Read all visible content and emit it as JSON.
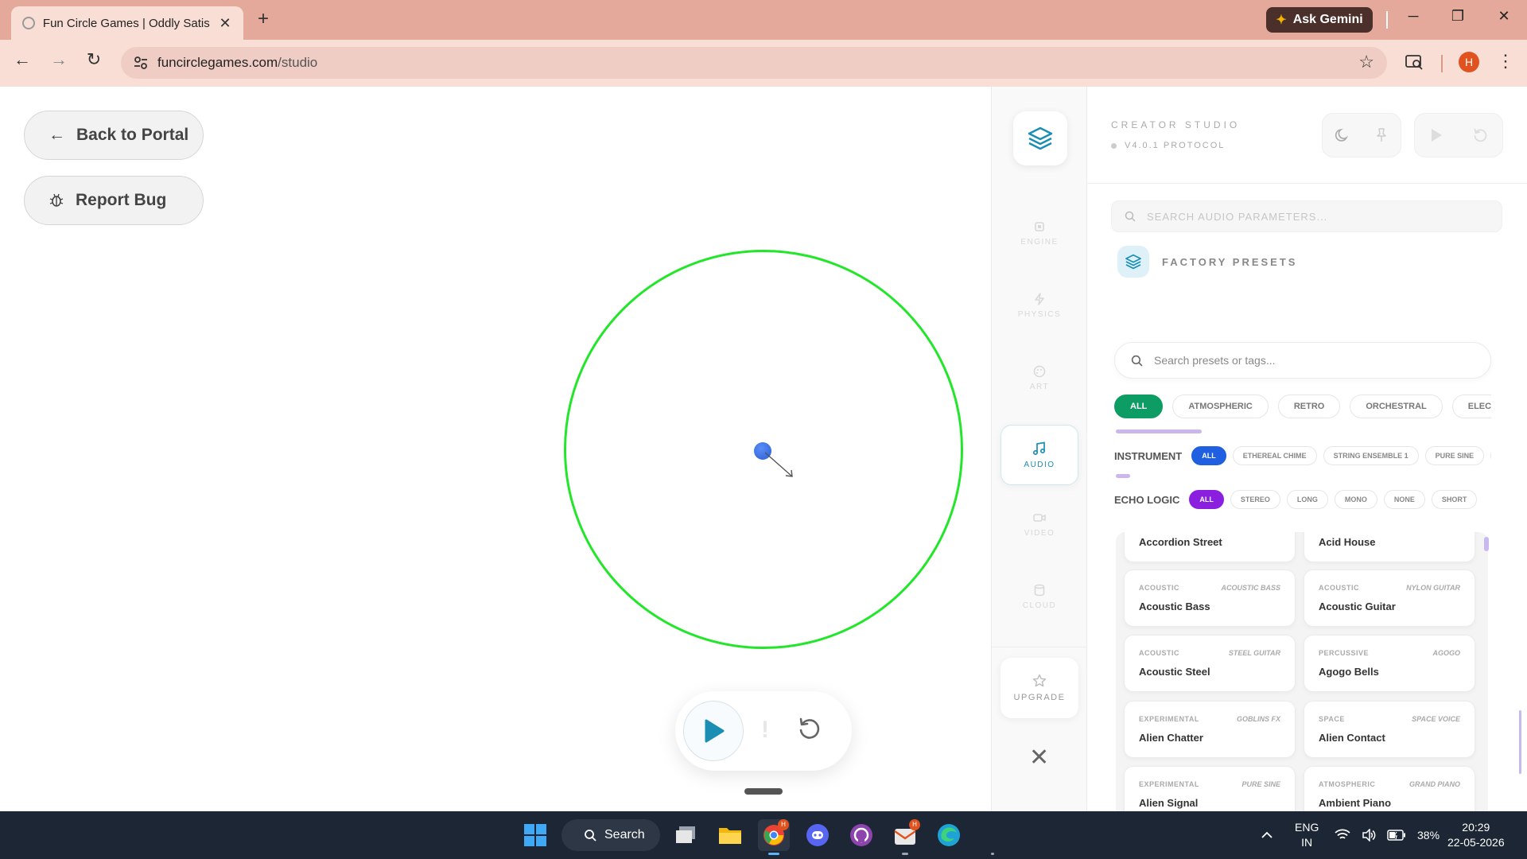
{
  "browser": {
    "tab_title": "Fun Circle Games | Oddly Satisfying",
    "gemini_label": "Ask Gemini",
    "url_domain": "funcirclegames.com",
    "url_path": "/studio",
    "profile_initial": "H"
  },
  "page": {
    "back_label": "Back to Portal",
    "report_label": "Report Bug"
  },
  "rail": {
    "items": [
      "ENGINE",
      "PHYSICS",
      "ART",
      "AUDIO",
      "VIDEO",
      "CLOUD"
    ],
    "active": "AUDIO",
    "upgrade_label": "UPGRADE"
  },
  "studio": {
    "title": "CREATOR STUDIO",
    "version": "V4.0.1 PROTOCOL",
    "param_search_placeholder": "SEARCH AUDIO PARAMETERS...",
    "presets_label": "FACTORY PRESETS",
    "preset_search_placeholder": "Search presets or tags...",
    "categories": [
      "ALL",
      "ATMOSPHERIC",
      "RETRO",
      "ORCHESTRAL",
      "ELECTRO"
    ],
    "instrument_label": "INSTRUMENT",
    "instruments": [
      "ALL",
      "ETHEREAL CHIME",
      "STRING ENSEMBLE 1",
      "PURE SINE",
      "F"
    ],
    "echo_label": "ECHO LOGIC",
    "echo_options": [
      "ALL",
      "STEREO",
      "LONG",
      "MONO",
      "NONE",
      "SHORT"
    ],
    "presets": [
      {
        "category": "",
        "tag": "",
        "name": "Accordion Street"
      },
      {
        "category": "",
        "tag": "",
        "name": "Acid House"
      },
      {
        "category": "ACOUSTIC",
        "tag": "ACOUSTIC BASS",
        "name": "Acoustic Bass"
      },
      {
        "category": "ACOUSTIC",
        "tag": "NYLON GUITAR",
        "name": "Acoustic Guitar"
      },
      {
        "category": "ACOUSTIC",
        "tag": "STEEL GUITAR",
        "name": "Acoustic Steel"
      },
      {
        "category": "PERCUSSIVE",
        "tag": "AGOGO",
        "name": "Agogo Bells"
      },
      {
        "category": "EXPERIMENTAL",
        "tag": "GOBLINS FX",
        "name": "Alien Chatter"
      },
      {
        "category": "SPACE",
        "tag": "SPACE VOICE",
        "name": "Alien Contact"
      },
      {
        "category": "EXPERIMENTAL",
        "tag": "PURE SINE",
        "name": "Alien Signal"
      },
      {
        "category": "ATMOSPHERIC",
        "tag": "GRAND PIANO",
        "name": "Ambient Piano"
      }
    ]
  },
  "taskbar": {
    "search_label": "Search",
    "lang_top": "ENG",
    "lang_bottom": "IN",
    "battery": "38%",
    "time": "20:29",
    "date": "22-05-2026",
    "badge_letter": "H"
  },
  "colors": {
    "ring": "#22e62a",
    "ball": "#2a5fd6",
    "accent": "#1a8fb3",
    "chip_green": "#0d9c63",
    "chip_blue": "#1f5fe0",
    "chip_purple": "#8a1fe0"
  }
}
